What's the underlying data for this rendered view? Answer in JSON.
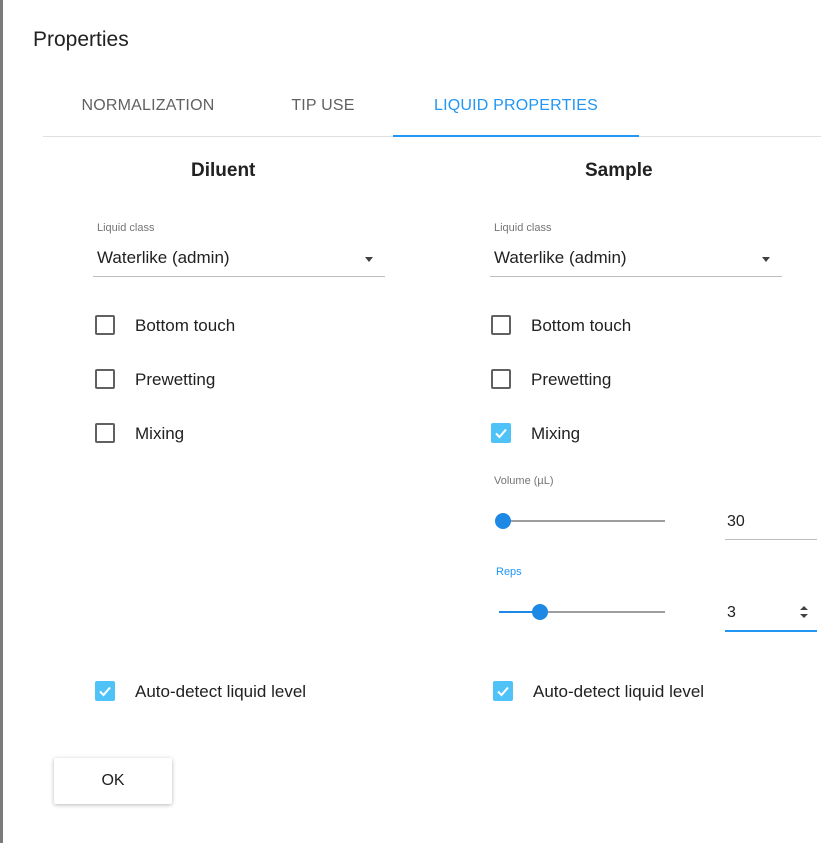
{
  "dialog": {
    "title": "Properties",
    "ok_label": "OK"
  },
  "tabs": [
    {
      "label": "NORMALIZATION",
      "active": false
    },
    {
      "label": "TIP USE",
      "active": false
    },
    {
      "label": "LIQUID PROPERTIES",
      "active": true
    }
  ],
  "diluent": {
    "title": "Diluent",
    "liquid_class_label": "Liquid class",
    "liquid_class_value": "Waterlike (admin)",
    "checkboxes": [
      {
        "label": "Bottom touch",
        "checked": false
      },
      {
        "label": "Prewetting",
        "checked": false
      },
      {
        "label": "Mixing",
        "checked": false
      }
    ],
    "auto_detect": {
      "label": "Auto-detect liquid level",
      "checked": true
    }
  },
  "sample": {
    "title": "Sample",
    "liquid_class_label": "Liquid class",
    "liquid_class_value": "Waterlike (admin)",
    "checkboxes": [
      {
        "label": "Bottom touch",
        "checked": false
      },
      {
        "label": "Prewetting",
        "checked": false
      },
      {
        "label": "Mixing",
        "checked": true
      }
    ],
    "volume": {
      "label": "Volume (µL)",
      "value": "30",
      "slider_fraction": 0.0
    },
    "reps": {
      "label": "Reps",
      "value": "3",
      "slider_fraction": 0.22
    },
    "auto_detect": {
      "label": "Auto-detect liquid level",
      "checked": true
    }
  },
  "colors": {
    "accent": "#2196f3",
    "checkbox_checked": "#4fc3f7",
    "slider": "#1e88e5"
  }
}
